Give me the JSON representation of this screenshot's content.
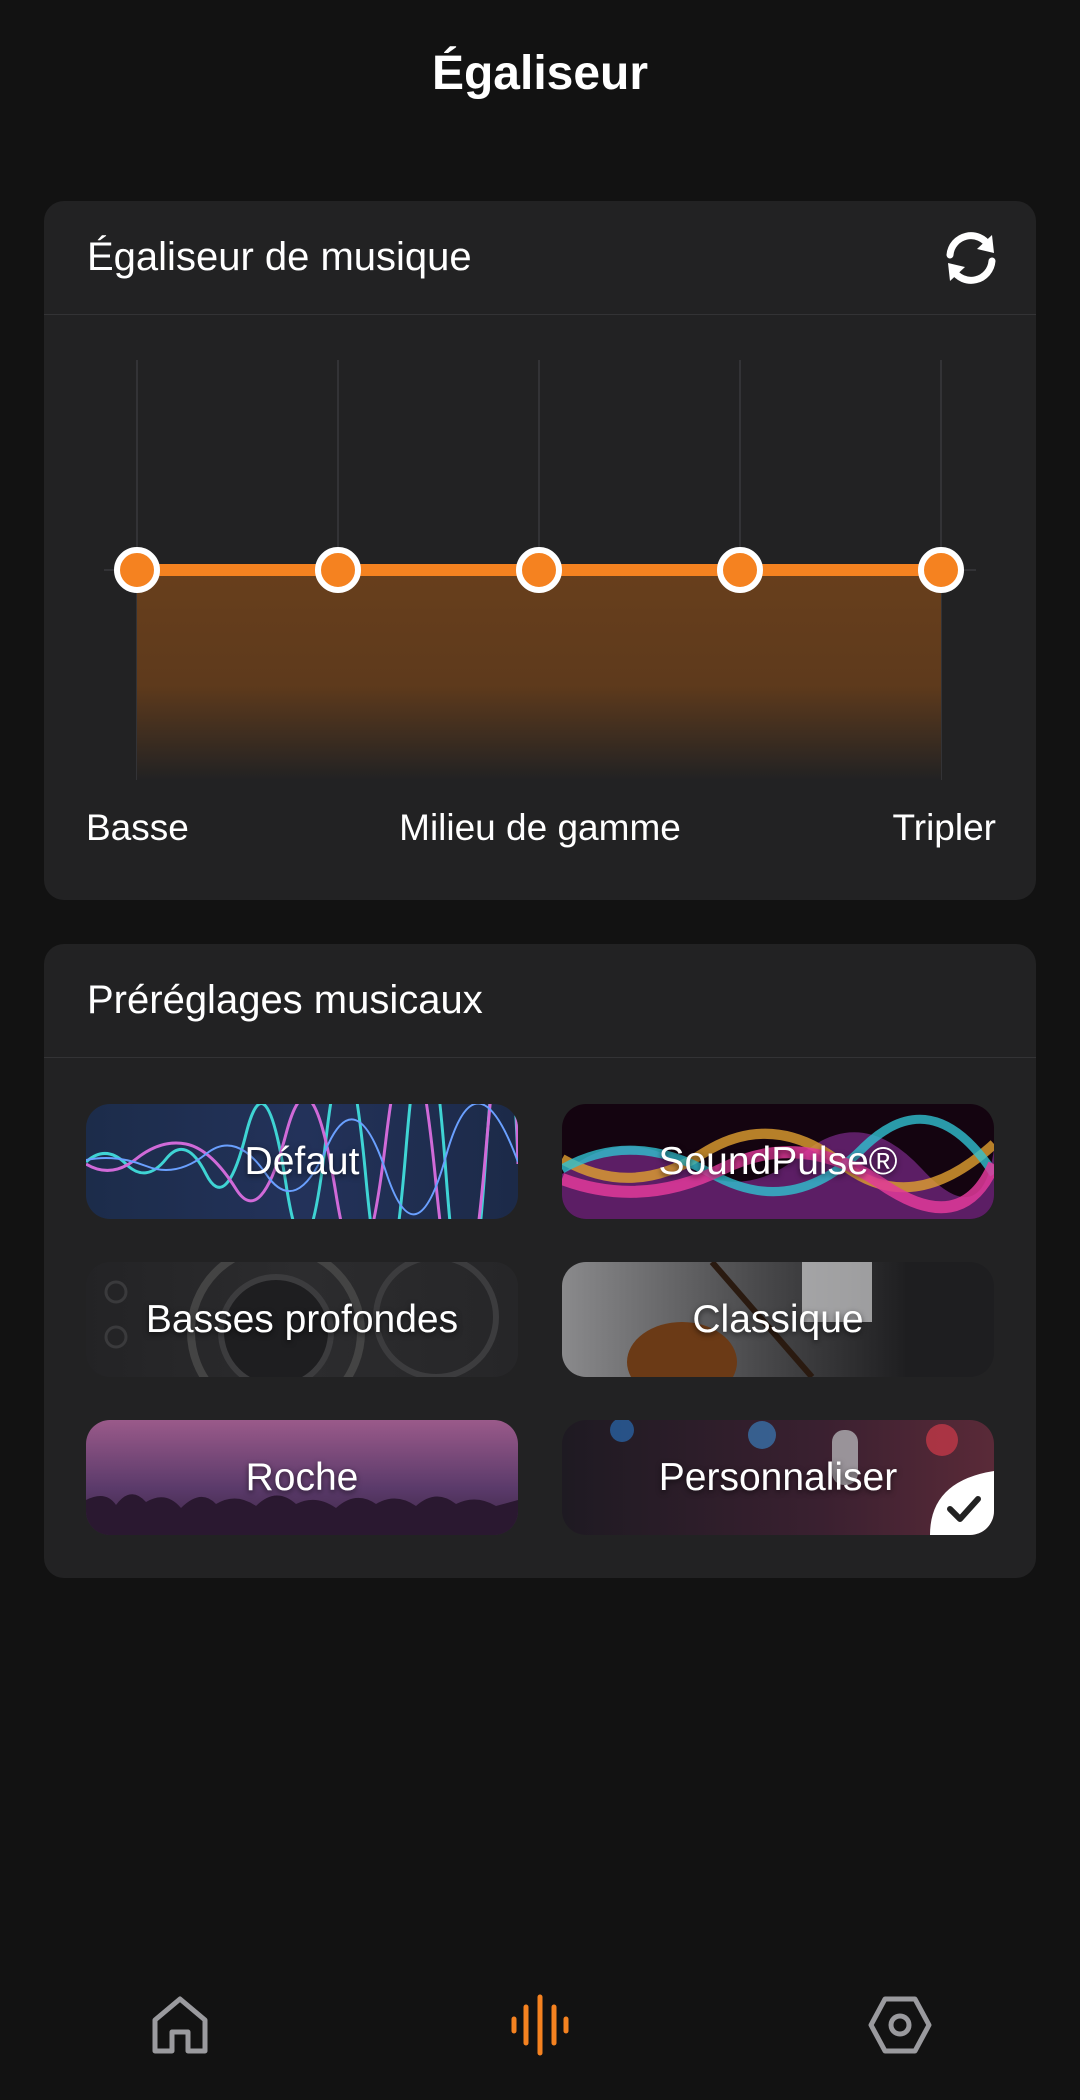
{
  "header": {
    "title": "Égaliseur"
  },
  "equalizer": {
    "title": "Égaliseur de musique",
    "reset_icon": "refresh-icon",
    "accent": "#F58220",
    "band_labels": {
      "low": "Basse",
      "mid": "Milieu de gamme",
      "high": "Tripler"
    }
  },
  "presets": {
    "title": "Préréglages musicaux",
    "items": [
      {
        "label": "Défaut",
        "selected": false
      },
      {
        "label": "SoundPulse®",
        "selected": false
      },
      {
        "label": "Basses profondes",
        "selected": false
      },
      {
        "label": "Classique",
        "selected": false
      },
      {
        "label": "Roche",
        "selected": false
      },
      {
        "label": "Personnaliser",
        "selected": true
      }
    ]
  },
  "nav": {
    "items": [
      {
        "icon": "home-icon",
        "active": false
      },
      {
        "icon": "equalizer-wave-icon",
        "active": true
      },
      {
        "icon": "settings-hexagon-icon",
        "active": false
      }
    ]
  }
}
